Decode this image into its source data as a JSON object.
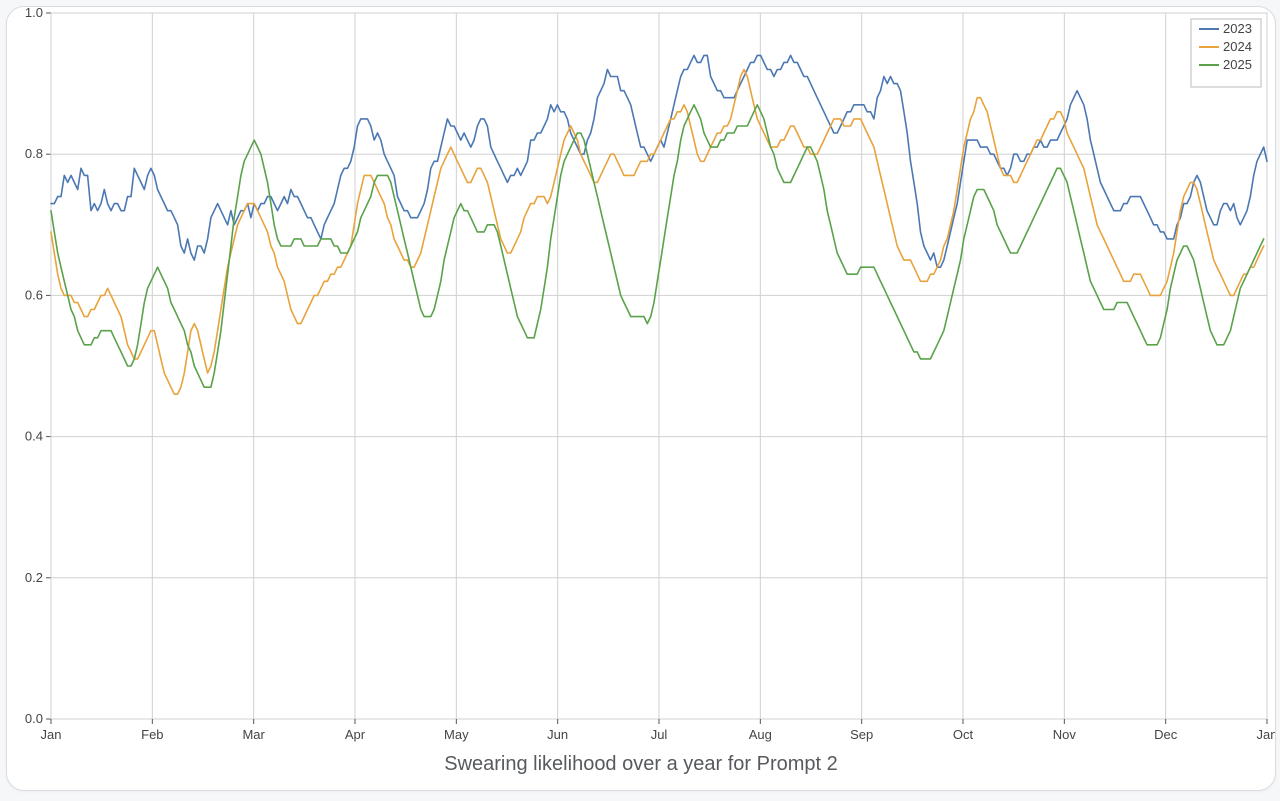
{
  "caption": "Swearing likelihood over a year for Prompt 2",
  "legend": {
    "items": [
      "2023",
      "2024",
      "2025"
    ]
  },
  "axes": {
    "x_ticks": [
      "Jan",
      "Feb",
      "Mar",
      "Apr",
      "May",
      "Jun",
      "Jul",
      "Aug",
      "Sep",
      "Oct",
      "Nov",
      "Dec",
      "Jan"
    ],
    "y_ticks": [
      "0.0",
      "0.2",
      "0.4",
      "0.6",
      "0.8",
      "1.0"
    ]
  },
  "colors": {
    "2023": "#4b78b3",
    "2024": "#e8a33d",
    "2025": "#5aa24a"
  },
  "chart_data": {
    "type": "line",
    "xlabel": "",
    "ylabel": "",
    "title": "",
    "ylim": [
      0.0,
      1.0
    ],
    "categories": [
      "Jan",
      "Feb",
      "Mar",
      "Apr",
      "May",
      "Jun",
      "Jul",
      "Aug",
      "Sep",
      "Oct",
      "Nov",
      "Dec",
      "Jan"
    ],
    "series": [
      {
        "name": "2023",
        "color": "#4b78b3",
        "values": [
          0.73,
          0.73,
          0.74,
          0.74,
          0.77,
          0.76,
          0.77,
          0.76,
          0.75,
          0.78,
          0.77,
          0.77,
          0.72,
          0.73,
          0.72,
          0.73,
          0.75,
          0.73,
          0.72,
          0.73,
          0.73,
          0.72,
          0.72,
          0.74,
          0.74,
          0.78,
          0.77,
          0.76,
          0.75,
          0.77,
          0.78,
          0.77,
          0.75,
          0.74,
          0.73,
          0.72,
          0.72,
          0.71,
          0.7,
          0.67,
          0.66,
          0.68,
          0.66,
          0.65,
          0.67,
          0.67,
          0.66,
          0.68,
          0.71,
          0.72,
          0.73,
          0.72,
          0.71,
          0.7,
          0.72,
          0.7,
          0.71,
          0.72,
          0.72,
          0.73,
          0.71,
          0.73,
          0.72,
          0.73,
          0.73,
          0.74,
          0.74,
          0.73,
          0.72,
          0.73,
          0.74,
          0.73,
          0.75,
          0.74,
          0.74,
          0.73,
          0.72,
          0.71,
          0.71,
          0.7,
          0.69,
          0.68,
          0.7,
          0.71,
          0.72,
          0.73,
          0.75,
          0.77,
          0.78,
          0.78,
          0.79,
          0.81,
          0.84,
          0.85,
          0.85,
          0.85,
          0.84,
          0.82,
          0.83,
          0.82,
          0.8,
          0.79,
          0.78,
          0.77,
          0.74,
          0.73,
          0.72,
          0.72,
          0.71,
          0.71,
          0.71,
          0.72,
          0.73,
          0.75,
          0.78,
          0.79,
          0.79,
          0.81,
          0.83,
          0.85,
          0.84,
          0.84,
          0.83,
          0.82,
          0.83,
          0.82,
          0.81,
          0.82,
          0.84,
          0.85,
          0.85,
          0.84,
          0.81,
          0.8,
          0.79,
          0.78,
          0.77,
          0.76,
          0.77,
          0.77,
          0.78,
          0.77,
          0.78,
          0.79,
          0.82,
          0.82,
          0.83,
          0.83,
          0.84,
          0.85,
          0.87,
          0.86,
          0.87,
          0.86,
          0.86,
          0.85,
          0.83,
          0.82,
          0.81,
          0.8,
          0.8,
          0.82,
          0.83,
          0.85,
          0.88,
          0.89,
          0.9,
          0.92,
          0.91,
          0.91,
          0.91,
          0.89,
          0.89,
          0.88,
          0.87,
          0.85,
          0.83,
          0.81,
          0.81,
          0.8,
          0.79,
          0.8,
          0.81,
          0.82,
          0.81,
          0.83,
          0.85,
          0.87,
          0.89,
          0.91,
          0.92,
          0.92,
          0.93,
          0.94,
          0.93,
          0.93,
          0.94,
          0.94,
          0.91,
          0.9,
          0.89,
          0.89,
          0.88,
          0.88,
          0.88,
          0.88,
          0.89,
          0.9,
          0.91,
          0.92,
          0.93,
          0.93,
          0.94,
          0.94,
          0.93,
          0.92,
          0.92,
          0.91,
          0.92,
          0.92,
          0.93,
          0.93,
          0.94,
          0.93,
          0.93,
          0.92,
          0.91,
          0.91,
          0.9,
          0.89,
          0.88,
          0.87,
          0.86,
          0.85,
          0.84,
          0.83,
          0.83,
          0.84,
          0.85,
          0.86,
          0.86,
          0.87,
          0.87,
          0.87,
          0.87,
          0.86,
          0.86,
          0.85,
          0.88,
          0.89,
          0.91,
          0.9,
          0.91,
          0.9,
          0.9,
          0.89,
          0.86,
          0.83,
          0.79,
          0.76,
          0.73,
          0.69,
          0.67,
          0.66,
          0.65,
          0.66,
          0.64,
          0.64,
          0.65,
          0.67,
          0.69,
          0.71,
          0.73,
          0.76,
          0.79,
          0.82,
          0.82,
          0.82,
          0.82,
          0.81,
          0.81,
          0.81,
          0.8,
          0.8,
          0.79,
          0.78,
          0.78,
          0.77,
          0.78,
          0.8,
          0.8,
          0.79,
          0.79,
          0.8,
          0.8,
          0.81,
          0.81,
          0.82,
          0.81,
          0.81,
          0.82,
          0.82,
          0.82,
          0.83,
          0.84,
          0.85,
          0.87,
          0.88,
          0.89,
          0.88,
          0.87,
          0.85,
          0.82,
          0.8,
          0.78,
          0.76,
          0.75,
          0.74,
          0.73,
          0.72,
          0.72,
          0.72,
          0.73,
          0.73,
          0.74,
          0.74,
          0.74,
          0.74,
          0.73,
          0.72,
          0.71,
          0.7,
          0.7,
          0.69,
          0.69,
          0.68,
          0.68,
          0.68,
          0.7,
          0.71,
          0.73,
          0.73,
          0.74,
          0.76,
          0.77,
          0.76,
          0.74,
          0.72,
          0.71,
          0.7,
          0.7,
          0.72,
          0.73,
          0.73,
          0.72,
          0.73,
          0.71,
          0.7,
          0.71,
          0.72,
          0.74,
          0.77,
          0.79,
          0.8,
          0.81,
          0.79
        ]
      },
      {
        "name": "2024",
        "color": "#e8a33d",
        "values": [
          0.69,
          0.66,
          0.63,
          0.61,
          0.6,
          0.6,
          0.6,
          0.59,
          0.59,
          0.58,
          0.57,
          0.57,
          0.58,
          0.58,
          0.59,
          0.6,
          0.6,
          0.61,
          0.6,
          0.59,
          0.58,
          0.57,
          0.55,
          0.53,
          0.52,
          0.51,
          0.51,
          0.52,
          0.53,
          0.54,
          0.55,
          0.55,
          0.53,
          0.51,
          0.49,
          0.48,
          0.47,
          0.46,
          0.46,
          0.47,
          0.49,
          0.52,
          0.55,
          0.56,
          0.55,
          0.53,
          0.51,
          0.49,
          0.5,
          0.52,
          0.55,
          0.58,
          0.61,
          0.64,
          0.66,
          0.68,
          0.7,
          0.71,
          0.72,
          0.73,
          0.73,
          0.73,
          0.72,
          0.71,
          0.7,
          0.69,
          0.67,
          0.66,
          0.64,
          0.63,
          0.62,
          0.6,
          0.58,
          0.57,
          0.56,
          0.56,
          0.57,
          0.58,
          0.59,
          0.6,
          0.6,
          0.61,
          0.62,
          0.62,
          0.63,
          0.63,
          0.64,
          0.64,
          0.65,
          0.66,
          0.67,
          0.7,
          0.73,
          0.75,
          0.77,
          0.77,
          0.77,
          0.76,
          0.75,
          0.74,
          0.73,
          0.71,
          0.7,
          0.68,
          0.67,
          0.66,
          0.65,
          0.65,
          0.64,
          0.64,
          0.65,
          0.66,
          0.68,
          0.7,
          0.72,
          0.74,
          0.76,
          0.78,
          0.79,
          0.8,
          0.81,
          0.8,
          0.79,
          0.78,
          0.77,
          0.76,
          0.76,
          0.77,
          0.78,
          0.78,
          0.77,
          0.76,
          0.74,
          0.72,
          0.7,
          0.68,
          0.67,
          0.66,
          0.66,
          0.67,
          0.68,
          0.69,
          0.71,
          0.72,
          0.73,
          0.73,
          0.74,
          0.74,
          0.74,
          0.73,
          0.74,
          0.76,
          0.78,
          0.8,
          0.82,
          0.83,
          0.84,
          0.83,
          0.82,
          0.8,
          0.79,
          0.78,
          0.77,
          0.76,
          0.76,
          0.77,
          0.78,
          0.79,
          0.8,
          0.8,
          0.79,
          0.78,
          0.77,
          0.77,
          0.77,
          0.77,
          0.78,
          0.79,
          0.79,
          0.79,
          0.8,
          0.8,
          0.81,
          0.82,
          0.83,
          0.84,
          0.85,
          0.85,
          0.86,
          0.86,
          0.87,
          0.86,
          0.84,
          0.82,
          0.8,
          0.79,
          0.79,
          0.8,
          0.81,
          0.82,
          0.83,
          0.83,
          0.84,
          0.84,
          0.85,
          0.87,
          0.89,
          0.91,
          0.92,
          0.91,
          0.89,
          0.87,
          0.85,
          0.84,
          0.83,
          0.82,
          0.81,
          0.81,
          0.81,
          0.82,
          0.82,
          0.83,
          0.84,
          0.84,
          0.83,
          0.82,
          0.81,
          0.81,
          0.8,
          0.8,
          0.8,
          0.81,
          0.82,
          0.83,
          0.84,
          0.85,
          0.85,
          0.85,
          0.84,
          0.84,
          0.84,
          0.85,
          0.85,
          0.85,
          0.84,
          0.83,
          0.82,
          0.81,
          0.79,
          0.77,
          0.75,
          0.73,
          0.71,
          0.69,
          0.67,
          0.66,
          0.65,
          0.65,
          0.65,
          0.64,
          0.63,
          0.62,
          0.62,
          0.62,
          0.63,
          0.63,
          0.64,
          0.65,
          0.67,
          0.68,
          0.7,
          0.72,
          0.75,
          0.78,
          0.81,
          0.83,
          0.85,
          0.86,
          0.88,
          0.88,
          0.87,
          0.86,
          0.84,
          0.82,
          0.8,
          0.78,
          0.77,
          0.77,
          0.77,
          0.76,
          0.76,
          0.77,
          0.78,
          0.79,
          0.8,
          0.81,
          0.82,
          0.82,
          0.83,
          0.84,
          0.85,
          0.85,
          0.86,
          0.86,
          0.85,
          0.83,
          0.82,
          0.81,
          0.8,
          0.79,
          0.78,
          0.76,
          0.74,
          0.72,
          0.7,
          0.69,
          0.68,
          0.67,
          0.66,
          0.65,
          0.64,
          0.63,
          0.62,
          0.62,
          0.62,
          0.63,
          0.63,
          0.63,
          0.62,
          0.61,
          0.6,
          0.6,
          0.6,
          0.6,
          0.61,
          0.62,
          0.64,
          0.66,
          0.69,
          0.72,
          0.74,
          0.75,
          0.76,
          0.76,
          0.75,
          0.73,
          0.71,
          0.69,
          0.67,
          0.65,
          0.64,
          0.63,
          0.62,
          0.61,
          0.6,
          0.6,
          0.61,
          0.62,
          0.63,
          0.63,
          0.64,
          0.64,
          0.65,
          0.66,
          0.67
        ]
      },
      {
        "name": "2025",
        "color": "#5aa24a",
        "values": [
          0.72,
          0.69,
          0.66,
          0.64,
          0.62,
          0.6,
          0.58,
          0.57,
          0.55,
          0.54,
          0.53,
          0.53,
          0.53,
          0.54,
          0.54,
          0.55,
          0.55,
          0.55,
          0.55,
          0.54,
          0.53,
          0.52,
          0.51,
          0.5,
          0.5,
          0.51,
          0.53,
          0.56,
          0.59,
          0.61,
          0.62,
          0.63,
          0.64,
          0.63,
          0.62,
          0.61,
          0.59,
          0.58,
          0.57,
          0.56,
          0.55,
          0.53,
          0.52,
          0.5,
          0.49,
          0.48,
          0.47,
          0.47,
          0.47,
          0.49,
          0.52,
          0.55,
          0.59,
          0.63,
          0.67,
          0.71,
          0.74,
          0.77,
          0.79,
          0.8,
          0.81,
          0.82,
          0.81,
          0.8,
          0.78,
          0.76,
          0.73,
          0.7,
          0.68,
          0.67,
          0.67,
          0.67,
          0.67,
          0.68,
          0.68,
          0.68,
          0.67,
          0.67,
          0.67,
          0.67,
          0.67,
          0.68,
          0.68,
          0.68,
          0.68,
          0.67,
          0.67,
          0.66,
          0.66,
          0.66,
          0.67,
          0.68,
          0.69,
          0.71,
          0.72,
          0.73,
          0.74,
          0.76,
          0.77,
          0.77,
          0.77,
          0.77,
          0.76,
          0.74,
          0.72,
          0.7,
          0.68,
          0.66,
          0.64,
          0.62,
          0.6,
          0.58,
          0.57,
          0.57,
          0.57,
          0.58,
          0.6,
          0.62,
          0.65,
          0.67,
          0.69,
          0.71,
          0.72,
          0.73,
          0.72,
          0.72,
          0.71,
          0.7,
          0.69,
          0.69,
          0.69,
          0.7,
          0.7,
          0.7,
          0.69,
          0.67,
          0.65,
          0.63,
          0.61,
          0.59,
          0.57,
          0.56,
          0.55,
          0.54,
          0.54,
          0.54,
          0.56,
          0.58,
          0.61,
          0.64,
          0.68,
          0.71,
          0.74,
          0.77,
          0.79,
          0.8,
          0.81,
          0.82,
          0.83,
          0.83,
          0.82,
          0.8,
          0.78,
          0.76,
          0.74,
          0.72,
          0.7,
          0.68,
          0.66,
          0.64,
          0.62,
          0.6,
          0.59,
          0.58,
          0.57,
          0.57,
          0.57,
          0.57,
          0.57,
          0.56,
          0.57,
          0.59,
          0.62,
          0.65,
          0.68,
          0.71,
          0.74,
          0.77,
          0.79,
          0.82,
          0.84,
          0.85,
          0.86,
          0.87,
          0.86,
          0.85,
          0.83,
          0.82,
          0.81,
          0.81,
          0.81,
          0.82,
          0.82,
          0.83,
          0.83,
          0.83,
          0.84,
          0.84,
          0.84,
          0.84,
          0.85,
          0.86,
          0.87,
          0.86,
          0.85,
          0.83,
          0.81,
          0.8,
          0.78,
          0.77,
          0.76,
          0.76,
          0.76,
          0.77,
          0.78,
          0.79,
          0.8,
          0.81,
          0.81,
          0.8,
          0.79,
          0.77,
          0.75,
          0.72,
          0.7,
          0.68,
          0.66,
          0.65,
          0.64,
          0.63,
          0.63,
          0.63,
          0.63,
          0.64,
          0.64,
          0.64,
          0.64,
          0.64,
          0.63,
          0.62,
          0.61,
          0.6,
          0.59,
          0.58,
          0.57,
          0.56,
          0.55,
          0.54,
          0.53,
          0.52,
          0.52,
          0.51,
          0.51,
          0.51,
          0.51,
          0.52,
          0.53,
          0.54,
          0.55,
          0.57,
          0.59,
          0.61,
          0.63,
          0.65,
          0.68,
          0.7,
          0.72,
          0.74,
          0.75,
          0.75,
          0.75,
          0.74,
          0.73,
          0.72,
          0.7,
          0.69,
          0.68,
          0.67,
          0.66,
          0.66,
          0.66,
          0.67,
          0.68,
          0.69,
          0.7,
          0.71,
          0.72,
          0.73,
          0.74,
          0.75,
          0.76,
          0.77,
          0.78,
          0.78,
          0.77,
          0.76,
          0.74,
          0.72,
          0.7,
          0.68,
          0.66,
          0.64,
          0.62,
          0.61,
          0.6,
          0.59,
          0.58,
          0.58,
          0.58,
          0.58,
          0.59,
          0.59,
          0.59,
          0.59,
          0.58,
          0.57,
          0.56,
          0.55,
          0.54,
          0.53,
          0.53,
          0.53,
          0.53,
          0.54,
          0.56,
          0.58,
          0.61,
          0.63,
          0.65,
          0.66,
          0.67,
          0.67,
          0.66,
          0.65,
          0.63,
          0.61,
          0.59,
          0.57,
          0.55,
          0.54,
          0.53,
          0.53,
          0.53,
          0.54,
          0.55,
          0.57,
          0.59,
          0.61,
          0.62,
          0.63,
          0.64,
          0.65,
          0.66,
          0.67,
          0.68
        ]
      }
    ]
  }
}
